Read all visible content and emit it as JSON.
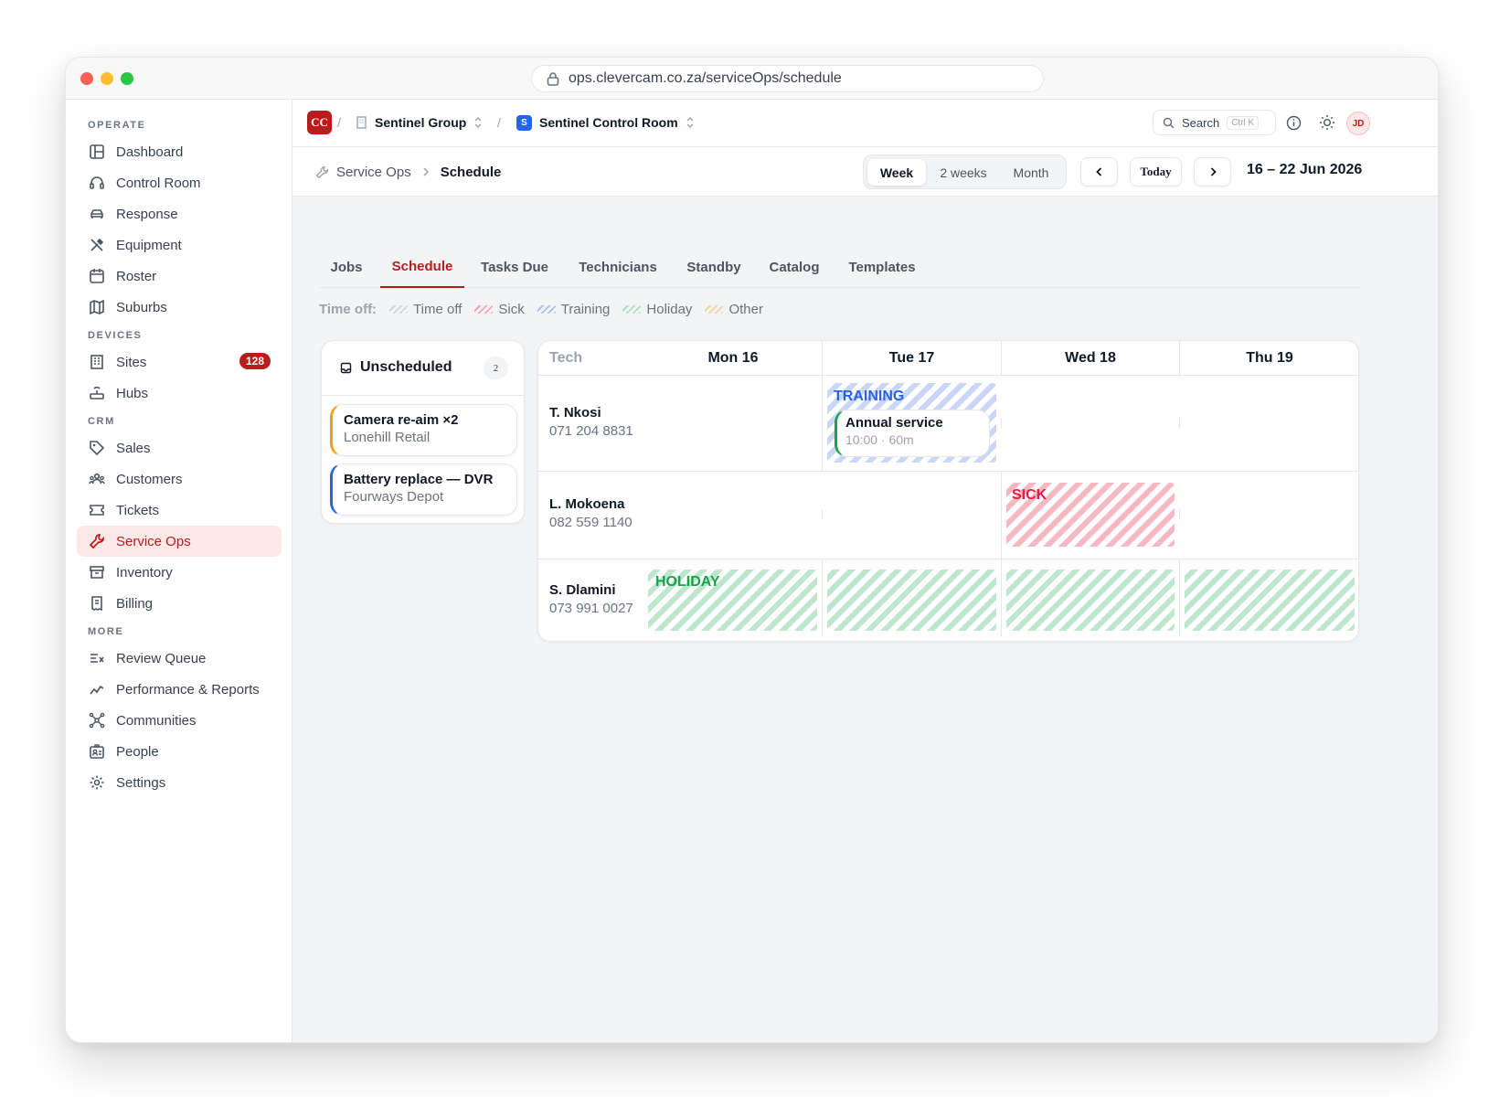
{
  "browser": {
    "url": "ops.clevercam.co.za/serviceOps/schedule"
  },
  "sidebar": {
    "sections": {
      "operate": "OPERATE",
      "devices": "DEVICES",
      "crm": "CRM",
      "more": "MORE"
    },
    "items": {
      "dashboard": "Dashboard",
      "control_room": "Control Room",
      "response": "Response",
      "equipment": "Equipment",
      "roster": "Roster",
      "suburbs": "Suburbs",
      "sites": "Sites",
      "sites_badge": "128",
      "hubs": "Hubs",
      "sales": "Sales",
      "customers": "Customers",
      "tickets": "Tickets",
      "service_ops": "Service Ops",
      "inventory": "Inventory",
      "billing": "Billing",
      "review_queue": "Review Queue",
      "performance": "Performance & Reports",
      "communities": "Communities",
      "people": "People",
      "settings": "Settings"
    }
  },
  "topbar": {
    "logo": "CC",
    "org": "Sentinel Group",
    "workspace_badge": "S",
    "workspace": "Sentinel Control Room",
    "search_label": "Search",
    "search_shortcut": "Ctrl K",
    "avatar": "JD",
    "sep": "/"
  },
  "subbar": {
    "breadcrumb_parent": "Service Ops",
    "breadcrumb_current": "Schedule",
    "views": [
      "Week",
      "2 weeks",
      "Month"
    ],
    "today": "Today",
    "range": "16 – 22 Jun 2026"
  },
  "tabs": [
    "Jobs",
    "Schedule",
    "Tasks Due",
    "Technicians",
    "Standby",
    "Catalog",
    "Templates"
  ],
  "legend": {
    "label": "Time off:",
    "items": [
      "Time off",
      "Sick",
      "Training",
      "Holiday",
      "Other"
    ]
  },
  "unscheduled": {
    "title": "Unscheduled",
    "count": "2",
    "jobs": [
      {
        "title": "Camera re-aim ×2",
        "site": "Lonehill Retail"
      },
      {
        "title": "Battery replace — DVR",
        "site": "Fourways Depot"
      }
    ]
  },
  "grid": {
    "tech_header": "Tech",
    "days": [
      "Mon 16",
      "Tue 17",
      "Wed 18",
      "Thu 19"
    ],
    "techs": [
      {
        "name": "T. Nkosi",
        "phone": "071 204 8831"
      },
      {
        "name": "L. Mokoena",
        "phone": "082 559 1140"
      },
      {
        "name": "S. Dlamini",
        "phone": "073 991 0027"
      }
    ],
    "labels": {
      "training": "TRAINING",
      "sick": "SICK",
      "holiday": "HOLIDAY"
    },
    "event": {
      "title": "Annual service",
      "meta": "10:00 · 60m"
    }
  },
  "colors": {
    "accent": "#b91c1c",
    "training": "#2563eb",
    "sick": "#e11d48",
    "holiday": "#16a34a",
    "other": "#f59e0b"
  }
}
